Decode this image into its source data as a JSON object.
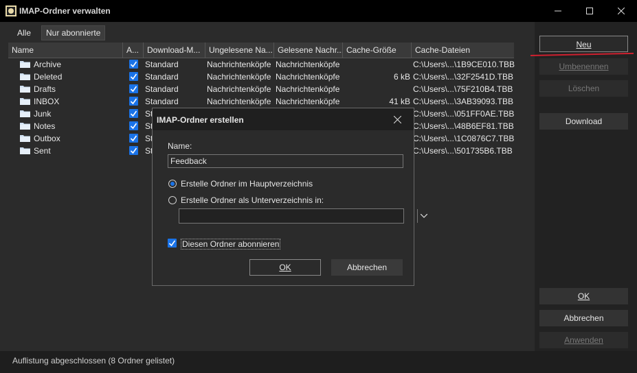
{
  "window": {
    "title": "IMAP-Ordner verwalten"
  },
  "tabs": [
    {
      "label": "Alle"
    },
    {
      "label": "Nur abonnierte"
    }
  ],
  "columns": [
    "Name",
    "A...",
    "Download-M...",
    "Ungelesene Na...",
    "Gelesene Nachr...",
    "Cache-Größe",
    "Cache-Dateien"
  ],
  "rows": [
    {
      "name": "Archive",
      "download": "Standard",
      "unread": "Nachrichtenköpfe",
      "read": "Nachrichtenköpfe",
      "size": "",
      "file": "C:\\Users\\...\\1B9CE010.TBB"
    },
    {
      "name": "Deleted",
      "download": "Standard",
      "unread": "Nachrichtenköpfe",
      "read": "Nachrichtenköpfe",
      "size": "6 kB",
      "file": "C:\\Users\\...\\32F2541D.TBB"
    },
    {
      "name": "Drafts",
      "download": "Standard",
      "unread": "Nachrichtenköpfe",
      "read": "Nachrichtenköpfe",
      "size": "",
      "file": "C:\\Users\\...\\75F210B4.TBB"
    },
    {
      "name": "INBOX",
      "download": "Standard",
      "unread": "Nachrichtenköpfe",
      "read": "Nachrichtenköpfe",
      "size": "41 kB",
      "file": "C:\\Users\\...\\3AB39093.TBB"
    },
    {
      "name": "Junk",
      "download": "St",
      "unread": "",
      "read": "",
      "size": "",
      "file": "C:\\Users\\...\\051FF0AE.TBB"
    },
    {
      "name": "Notes",
      "download": "St",
      "unread": "",
      "read": "",
      "size": "",
      "file": "C:\\Users\\...\\48B6EF81.TBB"
    },
    {
      "name": "Outbox",
      "download": "St",
      "unread": "",
      "read": "",
      "size": "",
      "file": "C:\\Users\\...\\1C0876C7.TBB"
    },
    {
      "name": "Sent",
      "download": "St",
      "unread": "",
      "read": "",
      "size": "",
      "file": "C:\\Users\\...\\501735B6.TBB"
    }
  ],
  "buttons": {
    "neu": "Neu",
    "umbenennen": "Umbenennen",
    "loeschen": "Löschen",
    "download": "Download",
    "ok": "OK",
    "abbrechen": "Abbrechen",
    "anwenden": "Anwenden"
  },
  "status": "Auflistung abgeschlossen (8 Ordner gelistet)",
  "dialog": {
    "title": "IMAP-Ordner erstellen",
    "name_label": "Name:",
    "name_value": "Feedback",
    "radio_root": "Erstelle Ordner im Hauptverzeichnis",
    "radio_sub": "Erstelle Ordner als Unterverzeichnis in:",
    "subscribe_label": "Diesen Ordner abonnieren",
    "ok": "OK",
    "cancel": "Abbrechen"
  },
  "colors": {
    "accent": "#1a73e8",
    "highlight_line": "#d0202f"
  }
}
